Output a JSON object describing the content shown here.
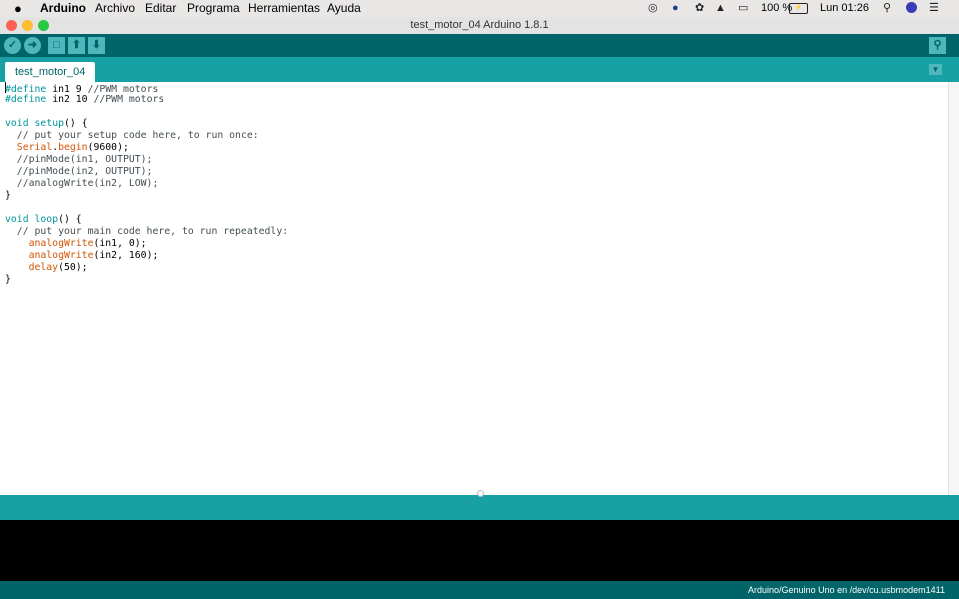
{
  "menubar": {
    "apple": "",
    "app": "Arduino",
    "items": [
      "Archivo",
      "Editar",
      "Programa",
      "Herramientas",
      "Ayuda"
    ],
    "status": {
      "battery_percent": "100 %",
      "clock": "Lun 01:26"
    },
    "status_icons": [
      "creative-cloud-icon",
      "app-status-icon",
      "sync-icon",
      "wifi-icon",
      "airplay-icon",
      "battery-icon",
      "search-icon",
      "siri-icon",
      "notification-center-icon"
    ]
  },
  "window": {
    "title": "test_motor_04 Arduino 1.8.1",
    "traffic_lights": {
      "close": "#fe5f57",
      "minimize": "#febc2e",
      "zoom": "#28c840"
    }
  },
  "toolbar": {
    "buttons": [
      "verify-icon",
      "upload-icon",
      "new-icon",
      "open-icon",
      "save-icon"
    ],
    "serial_monitor": "serial-monitor-icon"
  },
  "tabs": {
    "active": "test_motor_04",
    "menu_icon": "tab-menu-icon"
  },
  "code": {
    "lines": [
      [
        [
          "kw",
          "#define"
        ],
        [
          "",
          " in1 9 "
        ],
        [
          "cm",
          "//PWM motors"
        ]
      ],
      [
        [
          "kw",
          "#define"
        ],
        [
          "",
          " in2 10 "
        ],
        [
          "cm",
          "//PWM motors"
        ]
      ],
      [],
      [
        [
          "kw",
          "void"
        ],
        [
          "",
          " "
        ],
        [
          "kw",
          "setup"
        ],
        [
          "",
          "() {"
        ]
      ],
      [
        [
          "cm",
          "  // put your setup code here, to run once:"
        ]
      ],
      [
        [
          "",
          "  "
        ],
        [
          "fn",
          "Serial"
        ],
        [
          "",
          "."
        ],
        [
          "fn",
          "begin"
        ],
        [
          "",
          "(9600);"
        ]
      ],
      [
        [
          "cm",
          "  //pinMode(in1, OUTPUT);"
        ]
      ],
      [
        [
          "cm",
          "  //pinMode(in2, OUTPUT);"
        ]
      ],
      [
        [
          "cm",
          "  //analogWrite(in2, LOW);"
        ]
      ],
      [
        [
          "",
          "}"
        ]
      ],
      [],
      [
        [
          "kw",
          "void"
        ],
        [
          "",
          " "
        ],
        [
          "kw",
          "loop"
        ],
        [
          "",
          "() {"
        ]
      ],
      [
        [
          "cm",
          "  // put your main code here, to run repeatedly:"
        ]
      ],
      [
        [
          "",
          "    "
        ],
        [
          "fn",
          "analogWrite"
        ],
        [
          "",
          "(in1, 0);"
        ]
      ],
      [
        [
          "",
          "    "
        ],
        [
          "fn",
          "analogWrite"
        ],
        [
          "",
          "(in2, 160);"
        ]
      ],
      [
        [
          "",
          "    "
        ],
        [
          "fn",
          "delay"
        ],
        [
          "",
          "(50);"
        ]
      ],
      [
        [
          "",
          "}"
        ]
      ]
    ]
  },
  "status": {
    "board_port": "Arduino/Genuino Uno en /dev/cu.usbmodem1411"
  },
  "colors": {
    "toolbar": "#006468",
    "tabbar": "#17a1a5",
    "keyword": "#00979c",
    "function": "#d35400",
    "console": "#000000"
  }
}
